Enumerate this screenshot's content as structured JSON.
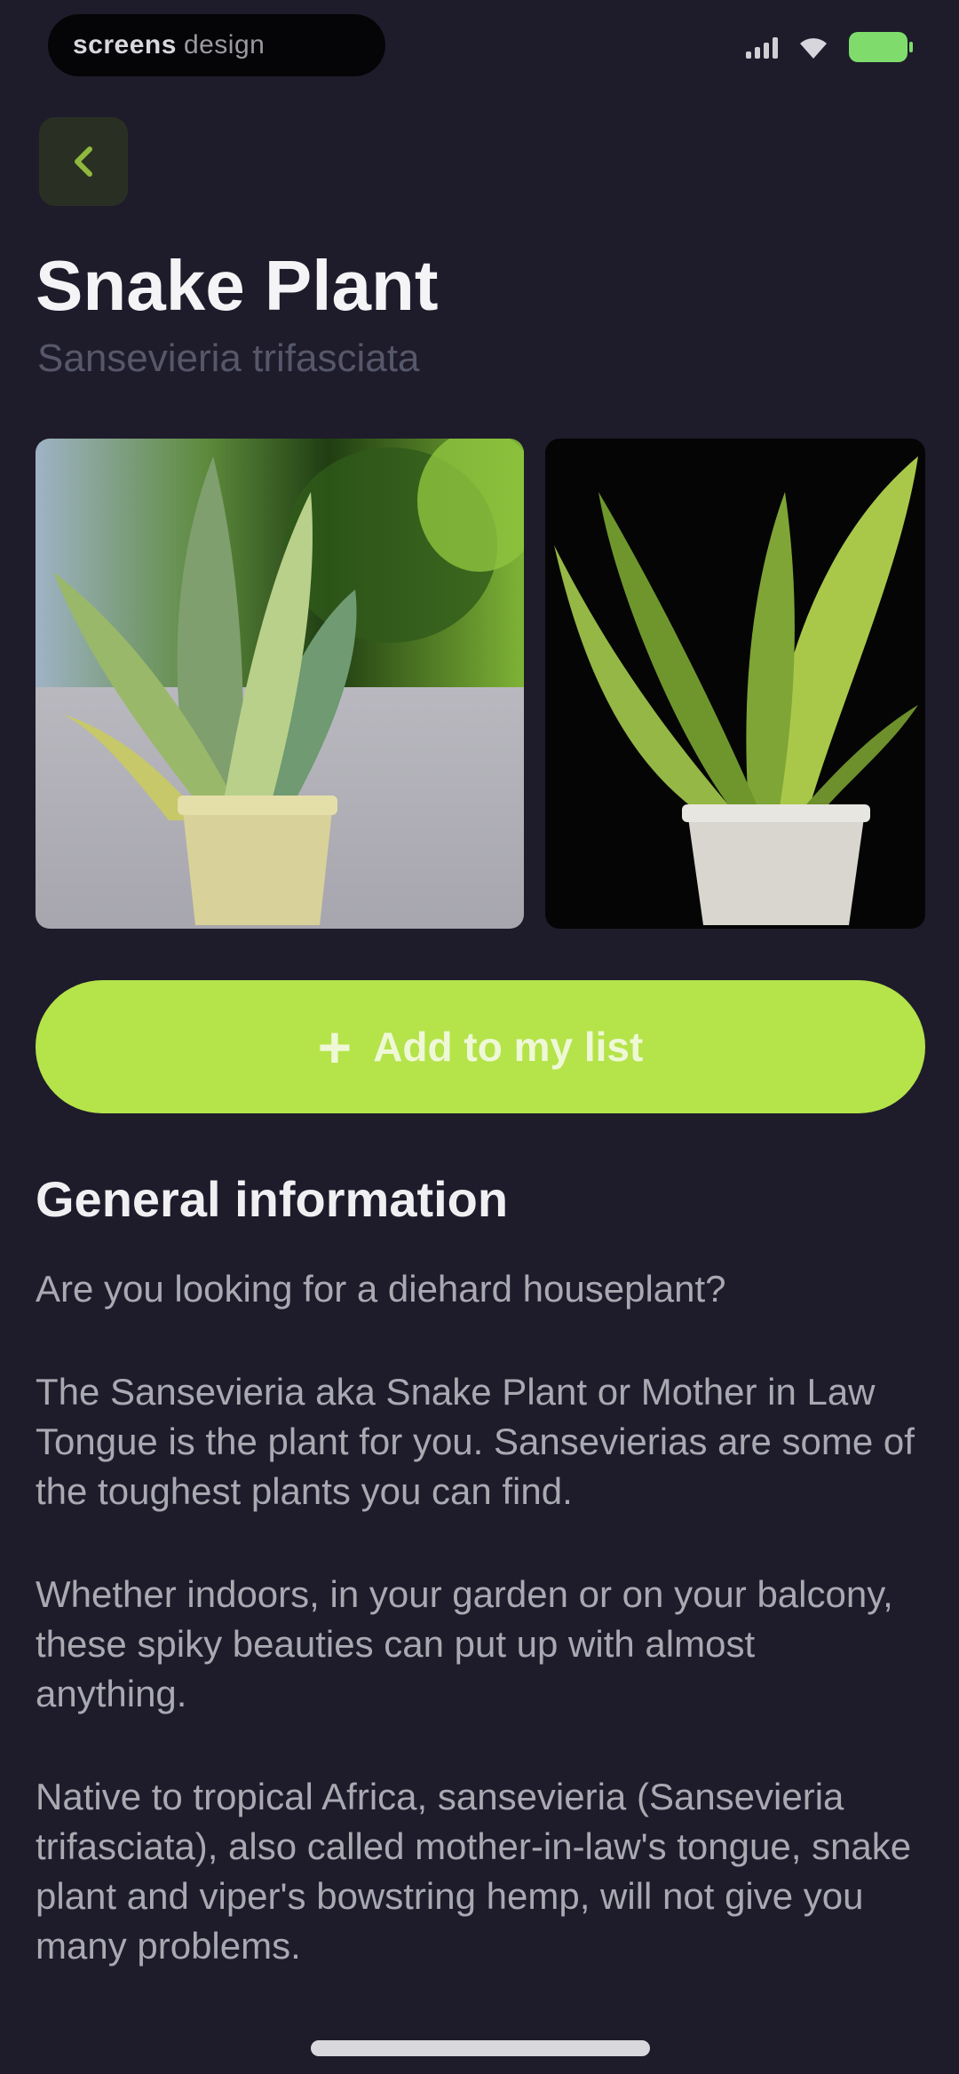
{
  "status_bar": {
    "carrier_bold": "screens",
    "carrier_rest": "design",
    "signal": "signal-icon",
    "wifi": "wifi-icon",
    "battery": "battery-icon"
  },
  "header": {
    "back_icon": "chevron-left-icon"
  },
  "plant": {
    "name": "Snake Plant",
    "latin_name": "Sansevieria trifasciata"
  },
  "gallery": {
    "photo_1": "snake plant in a yellow pot on a grey ledge",
    "photo_2": "snake plant in a white pot on a black background"
  },
  "actions": {
    "add_icon": "plus-icon",
    "add_label": "Add to my list"
  },
  "general": {
    "heading": "General information",
    "paragraphs": [
      "Are you looking for a diehard houseplant?",
      "The Sansevieria aka Snake Plant or Mother in Law Tongue is the plant for you. Sansevierias are some of the toughest plants you can find.",
      "Whether indoors, in your garden or on your balcony, these spiky beauties can put up with almost anything.",
      "Native to tropical Africa, sansevieria (Sansevieria trifasciata), also called mother-in-law's tongue, snake plant and viper's bowstring hemp, will not give you many problems."
    ]
  },
  "colors": {
    "background": "#1e1c2b",
    "accent": "#b5e34a",
    "muted_text": "#57576a",
    "body_text": "#a9a9b2"
  }
}
